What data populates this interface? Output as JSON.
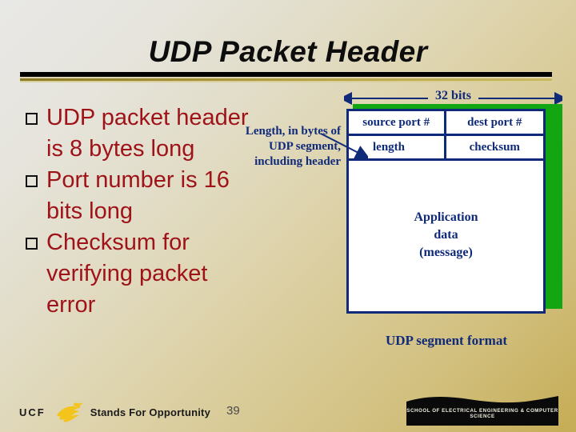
{
  "slide": {
    "title": "UDP Packet Header",
    "page_number": "39"
  },
  "bullets": [
    {
      "marker": "hollow-square",
      "text": "UDP packet header is 8 bytes long"
    },
    {
      "marker": "hollow-square",
      "text": "Port number is 16 bits long"
    },
    {
      "marker": "hollow-square",
      "text": "Checksum for verifying packet error"
    }
  ],
  "diagram": {
    "width_label": "32 bits",
    "callout": "Length, in bytes of UDP segment, including header",
    "caption": "UDP segment format",
    "fields": {
      "source_port": "source port #",
      "dest_port": "dest port #",
      "length": "length",
      "checksum": "checksum",
      "payload": "Application data (message)",
      "payload_line1": "Application",
      "payload_line2": "data",
      "payload_line3": "(message)"
    }
  },
  "footer": {
    "ucf_word": "UCF",
    "ucf_tagline": "Stands For Opportunity",
    "school_banner": "SCHOOL OF ELECTRICAL ENGINEERING & COMPUTER SCIENCE"
  },
  "colors": {
    "title_text": "#0d0d0d",
    "bullet_text": "#9e1218",
    "diagram_navy": "#102a7a",
    "shadow_green": "#12a712",
    "logo_gold": "#f5c518",
    "divider_black": "#000000",
    "divider_gold": "#b9a647"
  }
}
